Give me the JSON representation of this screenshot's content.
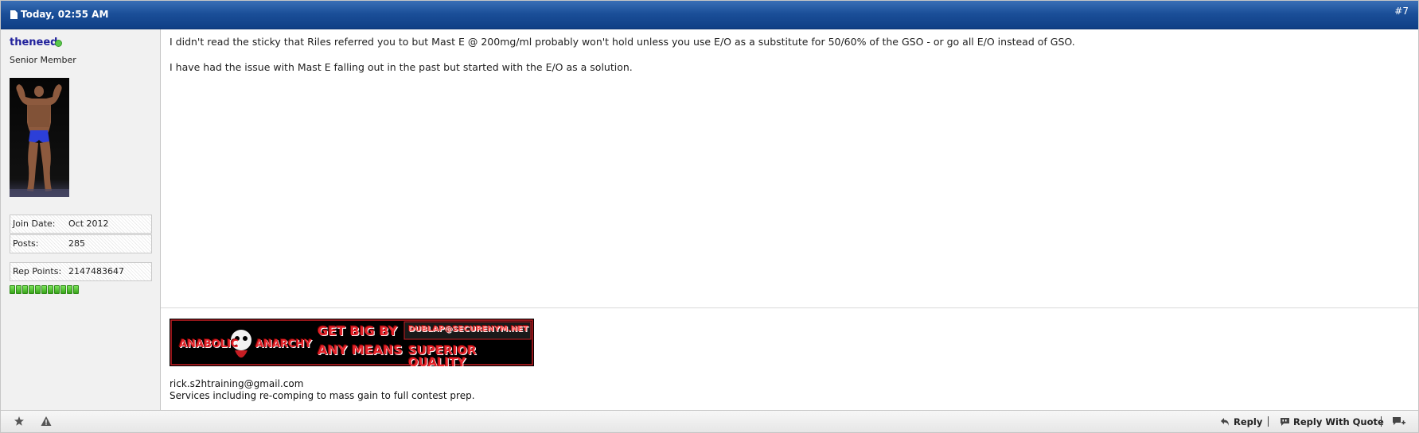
{
  "post": {
    "date": "Today, 02:55 AM",
    "number": "#7"
  },
  "user": {
    "name": "theneed",
    "title": "Senior Member",
    "stats": [
      {
        "label": "Join Date:",
        "value": "Oct 2012"
      },
      {
        "label": "Posts:",
        "value": "285"
      },
      {
        "label": "Rep Points:",
        "value": "2147483647"
      }
    ],
    "rep_pips": 11
  },
  "body": {
    "paragraphs": [
      "I didn't read the sticky that Riles referred you to but Mast E @ 200mg/ml probably won't hold unless you use E/O as a substitute for 50/60% of the GSO - or go all E/O instead of GSO.",
      "I have had the issue with Mast E falling out in the past but started with the E/O as a solution."
    ]
  },
  "signature": {
    "banner": {
      "left_1": "ANABOLIC",
      "left_2": "ANARCHY",
      "mid_1": "GET BIG BY",
      "mid_2": "ANY MEANS",
      "right_1": "DUBLAP@SECURENYM.NET",
      "right_2": "SUPERIOR QUALITY"
    },
    "email": "rick.s2htraining@gmail.com",
    "services": "Services including re-comping to mass gain to full contest prep."
  },
  "footer": {
    "reply": "Reply",
    "reply_with_quote": "Reply With Quote"
  },
  "colors": {
    "header_blue": "#1b4f99",
    "username": "#22229c",
    "rep_green": "#3aa41b",
    "banner_red": "#e5232a"
  }
}
